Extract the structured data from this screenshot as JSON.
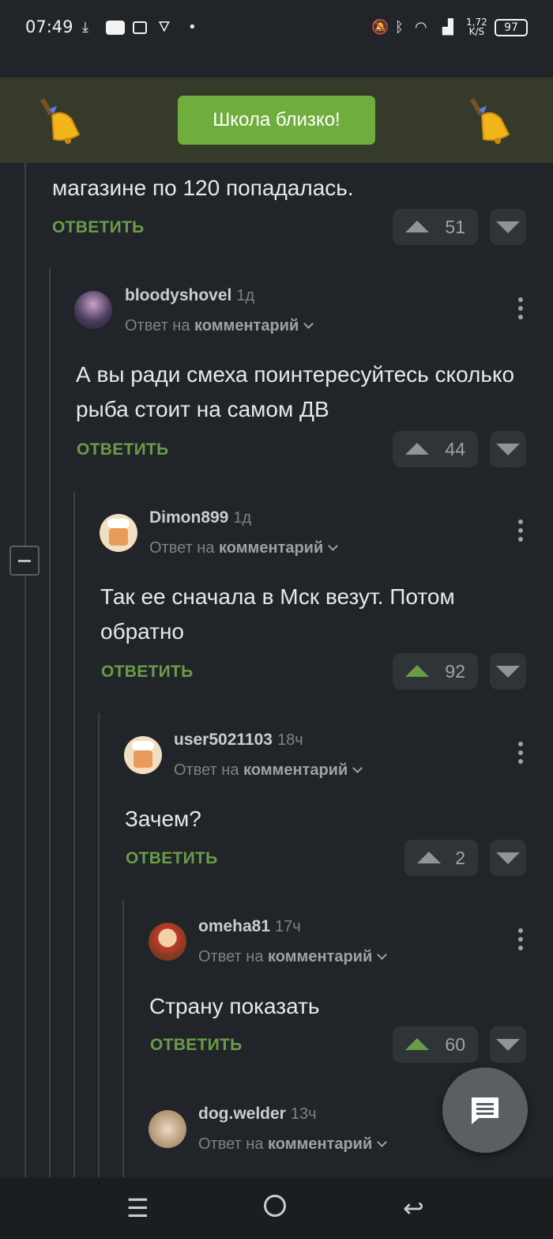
{
  "status_bar": {
    "time": "07:49",
    "net_speed": "1,72",
    "net_unit": "K/S",
    "battery": "97"
  },
  "banner": {
    "button_label": "Школа близко!"
  },
  "comments": [
    {
      "text_cut": "магазине по 120 попадалась.",
      "reply_label": "ОТВЕТИТЬ",
      "votes": "51"
    },
    {
      "user": "bloodyshovel",
      "time": "1д",
      "reply_prefix": "Ответ на",
      "reply_target": "комментарий",
      "text": "А вы ради смеха поинтересуйтесь сколько рыба стоит на самом ДВ",
      "reply_label": "ОТВЕТИТЬ",
      "votes": "44"
    },
    {
      "user": "Dimon899",
      "time": "1д",
      "reply_prefix": "Ответ на",
      "reply_target": "комментарий",
      "text": "Так ее сначала в Мск везут. Потом обратно",
      "reply_label": "ОТВЕТИТЬ",
      "votes": "92"
    },
    {
      "user": "user5021103",
      "time": "18ч",
      "reply_prefix": "Ответ на",
      "reply_target": "комментарий",
      "text": "Зачем?",
      "reply_label": "ОТВЕТИТЬ",
      "votes": "2"
    },
    {
      "user": "omeha81",
      "time": "17ч",
      "reply_prefix": "Ответ на",
      "reply_target": "комментарий",
      "text": "Страну показать",
      "reply_label": "ОТВЕТИТЬ",
      "votes": "60"
    },
    {
      "user": "dog.welder",
      "time": "13ч",
      "reply_prefix": "Ответ на",
      "reply_target": "комментарий"
    }
  ],
  "colors": {
    "accent": "#6a9c48",
    "background": "#212529",
    "banner_button": "#6fae3d"
  },
  "icons": [
    "download-icon",
    "youtube-icon",
    "nfc-icon",
    "mute-icon",
    "bluetooth-icon",
    "wifi-icon",
    "signal-icon",
    "bell-icon",
    "comment-icon",
    "menu-icon",
    "home-icon",
    "back-icon"
  ]
}
